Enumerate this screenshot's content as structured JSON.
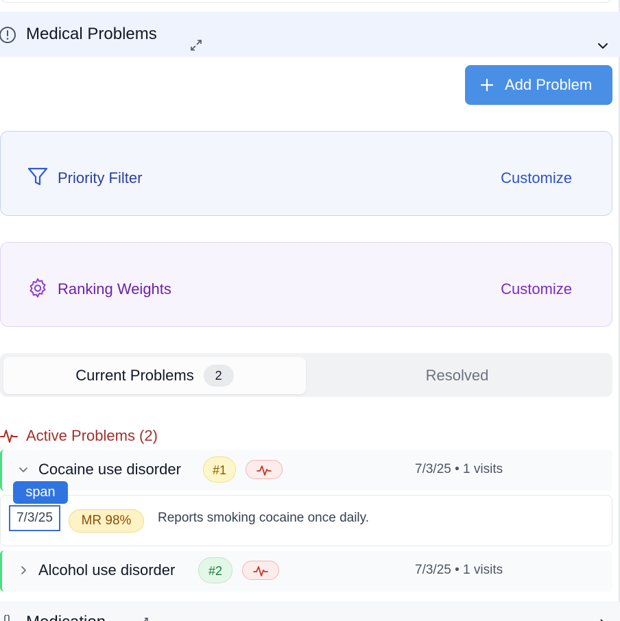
{
  "header": {
    "title": "Medical Problems"
  },
  "actions": {
    "add_label": "Add Problem"
  },
  "filters": {
    "priority_label": "Priority Filter",
    "priority_action": "Customize",
    "ranking_label": "Ranking Weights",
    "ranking_action": "Customize"
  },
  "tabs": {
    "current_label": "Current Problems",
    "current_count": "2",
    "resolved_label": "Resolved"
  },
  "active": {
    "label": "Active Problems (2)"
  },
  "problems": [
    {
      "name": "Cocaine use disorder",
      "rank": "#1",
      "meta": "7/3/25 • 1 visits"
    },
    {
      "name": "Alcohol use disorder",
      "rank": "#2",
      "meta": "7/3/25 • 1 visits"
    }
  ],
  "detail": {
    "date": "7/3/25",
    "confidence": "MR 98%",
    "note": "Reports smoking cocaine once daily."
  },
  "inspector": {
    "tag": "span"
  },
  "next_section": {
    "title": "Medication"
  },
  "colors": {
    "accent": "#4a8fe6",
    "header_bg": "#eff3fd",
    "active_red": "#a3302a",
    "priority_blue": "#2f52c8",
    "ranking_purple": "#7a2bc0"
  }
}
